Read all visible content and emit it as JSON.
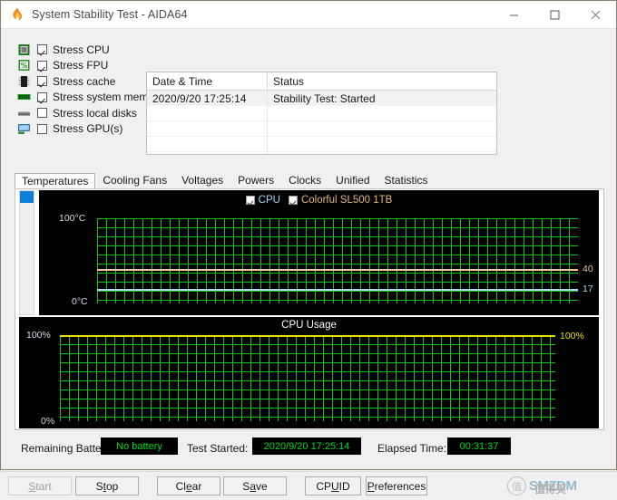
{
  "window": {
    "title": "System Stability Test - AIDA64",
    "icon": "flame-icon",
    "controls": {
      "minimize": "–",
      "maximize": "□",
      "close": "✕"
    }
  },
  "options": [
    {
      "label": "Stress CPU",
      "checked": true,
      "icon": "cpu-chip-icon"
    },
    {
      "label": "Stress FPU",
      "checked": true,
      "icon": "fpu-percent-icon"
    },
    {
      "label": "Stress cache",
      "checked": true,
      "icon": "cache-chip-icon"
    },
    {
      "label": "Stress system memory",
      "checked": true,
      "icon": "memory-stick-icon"
    },
    {
      "label": "Stress local disks",
      "checked": false,
      "icon": "hard-disk-icon"
    },
    {
      "label": "Stress GPU(s)",
      "checked": false,
      "icon": "gpu-monitor-icon"
    }
  ],
  "log": {
    "columns": [
      "Date & Time",
      "Status"
    ],
    "rows": [
      {
        "datetime": "2020/9/20 17:25:14",
        "status": "Stability Test: Started"
      }
    ],
    "empty_row_count": 4
  },
  "tabs": [
    {
      "label": "Temperatures",
      "active": true
    },
    {
      "label": "Cooling Fans",
      "active": false
    },
    {
      "label": "Voltages",
      "active": false
    },
    {
      "label": "Powers",
      "active": false
    },
    {
      "label": "Clocks",
      "active": false
    },
    {
      "label": "Unified",
      "active": false
    },
    {
      "label": "Statistics",
      "active": false
    }
  ],
  "chart_data": [
    {
      "type": "line",
      "name": "temperatures-chart",
      "title": "",
      "ylabel_top": "100°C",
      "ylabel_bottom": "0°C",
      "ylim": [
        0,
        100
      ],
      "grid": true,
      "grid_color": "#12c412",
      "background": "#000000",
      "legend_position": "top-center",
      "legend": [
        {
          "label": "CPU",
          "checked": true,
          "color": "#9fd8f5"
        },
        {
          "label": "Colorful SL500 1TB",
          "checked": true,
          "color": "#e3b97c"
        }
      ],
      "series": [
        {
          "name": "Colorful SL500 1TB",
          "value": 40,
          "unit": "°C",
          "end_label": "40",
          "color": "#e3c69a",
          "flat": true
        },
        {
          "name": "CPU",
          "value": 17,
          "unit": "°C",
          "end_label": "17",
          "color": "#a9d8ef",
          "flat": true
        }
      ]
    },
    {
      "type": "line",
      "name": "cpu-usage-chart",
      "title": "CPU Usage",
      "ylabel_top": "100%",
      "ylabel_bottom": "0%",
      "ylim": [
        0,
        100
      ],
      "grid": true,
      "grid_color": "#12c412",
      "background": "#000000",
      "legend_position": "none",
      "series": [
        {
          "name": "CPU Usage",
          "value": 100,
          "unit": "%",
          "end_label": "100%",
          "color": "#e8e000",
          "flat": true
        }
      ]
    }
  ],
  "status": {
    "battery_label": "Remaining Battery:",
    "battery_value": "No battery",
    "started_label": "Test Started:",
    "started_value": "2020/9/20 17:25:14",
    "elapsed_label": "Elapsed Time:",
    "elapsed_value": "00:31:37",
    "value_color": "#00d61e"
  },
  "buttons": [
    {
      "id": "start",
      "pre": "",
      "u": "S",
      "post": "tart",
      "disabled": true
    },
    {
      "id": "stop",
      "pre": "S",
      "u": "t",
      "post": "op",
      "disabled": false
    },
    {
      "id": "clear",
      "pre": "Cl",
      "u": "e",
      "post": "ar",
      "disabled": false
    },
    {
      "id": "save",
      "pre": "S",
      "u": "a",
      "post": "ve",
      "disabled": false
    },
    {
      "id": "cpuid",
      "pre": "CP",
      "u": "U",
      "post": "ID",
      "disabled": false
    },
    {
      "id": "preferences",
      "pre": "",
      "u": "P",
      "post": "references",
      "disabled": false
    }
  ],
  "watermark": {
    "mark": "值",
    "text": "SMZDM",
    "cjk": "值得买"
  }
}
